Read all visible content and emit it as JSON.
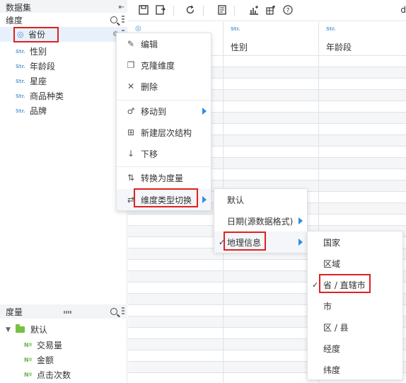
{
  "left_panel": {
    "dataset_title": "数据集",
    "dimension_title": "维度",
    "dimensions": [
      {
        "type": "geo",
        "label": "省份"
      },
      {
        "type": "Str.",
        "label": "性别"
      },
      {
        "type": "Str.",
        "label": "年龄段"
      },
      {
        "type": "Str.",
        "label": "星座"
      },
      {
        "type": "Str.",
        "label": "商品种类"
      },
      {
        "type": "Str.",
        "label": "品牌"
      }
    ],
    "measure_title": "度量",
    "measure_folder": "默认",
    "measures": [
      {
        "type": "Nº",
        "label": "交易量"
      },
      {
        "type": "Nº",
        "label": "金额"
      },
      {
        "type": "Nº",
        "label": "点击次数"
      }
    ]
  },
  "toolbar": {
    "right_text": "d"
  },
  "table": {
    "columns": [
      {
        "type": "",
        "name": ""
      },
      {
        "type": "Str.",
        "name": "性别"
      },
      {
        "type": "Str.",
        "name": "年龄段"
      }
    ]
  },
  "context_menu": {
    "items": [
      {
        "icon": "pencil-icon",
        "label": "编辑"
      },
      {
        "icon": "clone-icon",
        "label": "克隆维度"
      },
      {
        "icon": "close-icon",
        "label": "删除"
      },
      {
        "icon": "move-icon",
        "label": "移动到"
      },
      {
        "icon": "hierarchy-icon",
        "label": "新建层次结构"
      },
      {
        "icon": "arrow-down-icon",
        "label": "下移"
      },
      {
        "icon": "convert-icon",
        "label": "转换为度量"
      },
      {
        "icon": "switch-icon",
        "label": "维度类型切换"
      }
    ]
  },
  "type_menu": {
    "items": [
      "默认",
      "日期(源数据格式)",
      "地理信息"
    ]
  },
  "geo_menu": {
    "items": [
      "国家",
      "区域",
      "省 / 直辖市",
      "市",
      "区 / 县",
      "经度",
      "纬度"
    ]
  },
  "colors": {
    "accent_blue": "#2f8fe0",
    "highlight_red": "#e02020",
    "measure_green": "#66b84b",
    "selected_bg": "#e8f1fb"
  }
}
